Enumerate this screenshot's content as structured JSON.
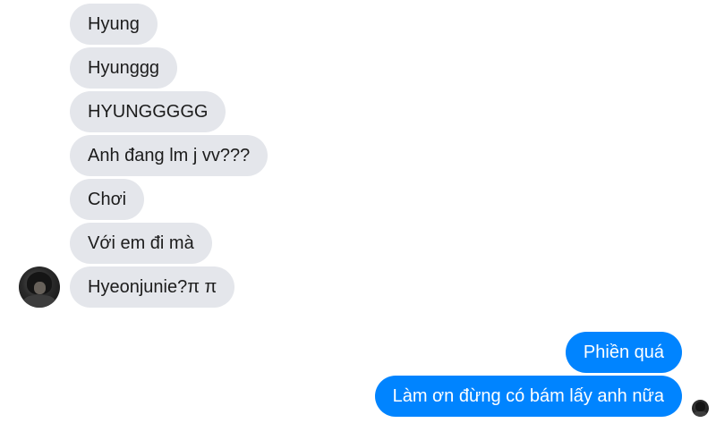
{
  "incoming": {
    "messages": [
      {
        "text": "Hyung"
      },
      {
        "text": "Hyunggg"
      },
      {
        "text": "HYUNGGGGG"
      },
      {
        "text": "Anh đang lm j vv???"
      },
      {
        "text": "Chơi"
      },
      {
        "text": "Với em đi mà"
      },
      {
        "text": "Hyeonjunie?π π"
      }
    ]
  },
  "outgoing": {
    "messages": [
      {
        "text": "Phiền quá"
      },
      {
        "text": "Làm ơn đừng có bám lấy anh nữa"
      }
    ]
  },
  "colors": {
    "incoming_bubble": "#e4e6eb",
    "outgoing_bubble": "#0084ff",
    "outgoing_text": "#ffffff"
  }
}
